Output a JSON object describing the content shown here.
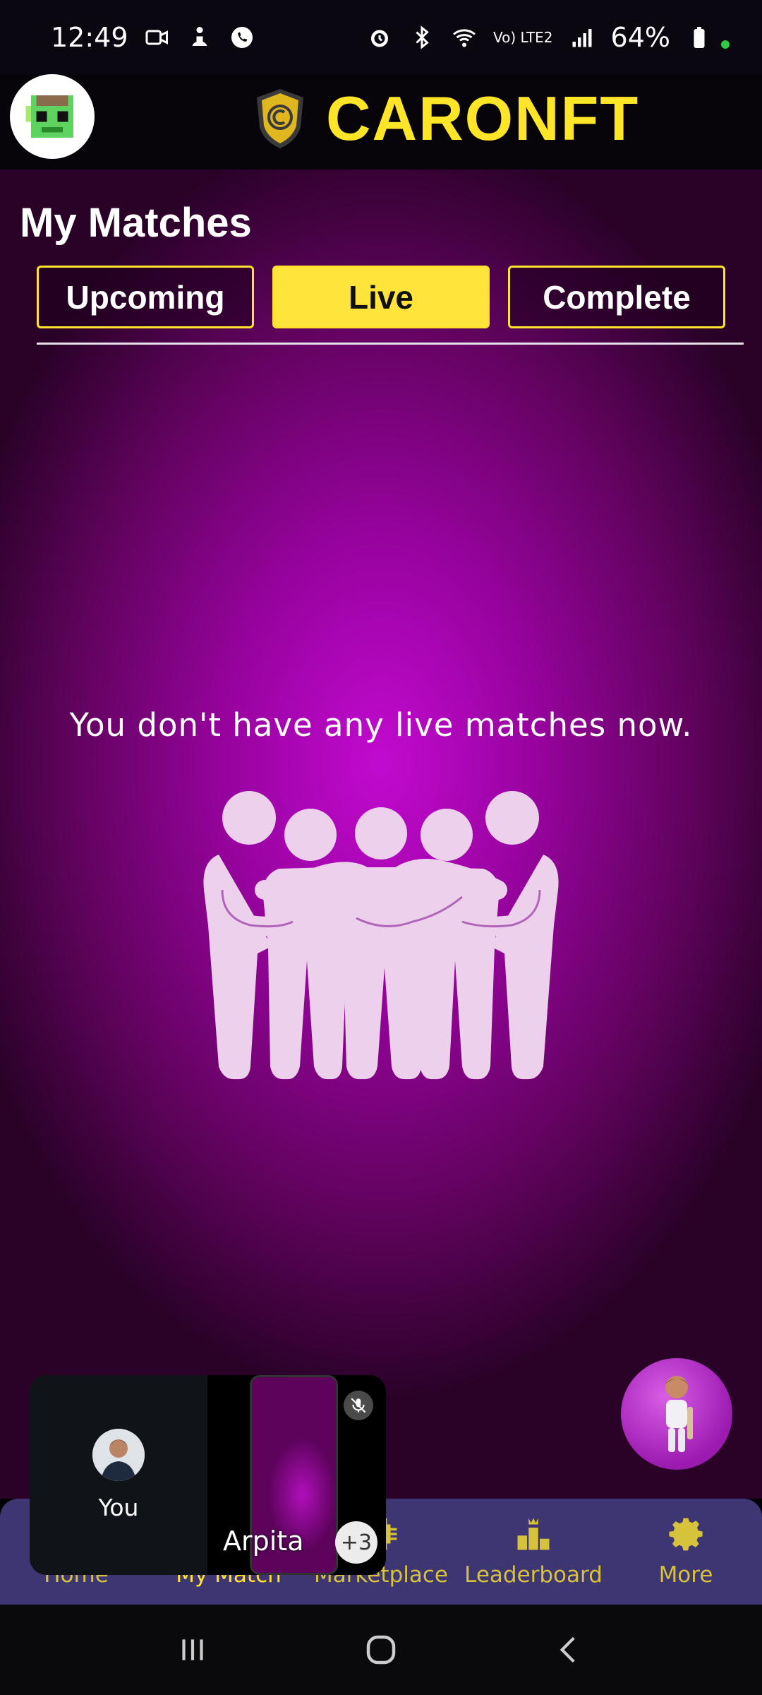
{
  "status_bar": {
    "time": "12:49",
    "battery": "64%",
    "network_label": "Vo) LTE2"
  },
  "header": {
    "brand_name": "CARONFT",
    "brand_color": "#ffe528"
  },
  "page": {
    "title": "My Matches",
    "tabs": [
      {
        "label": "Upcoming",
        "active": false
      },
      {
        "label": "Live",
        "active": true
      },
      {
        "label": "Complete",
        "active": false
      }
    ],
    "empty_message": "You don't have any live matches now."
  },
  "bottom_nav": {
    "items": [
      {
        "label": "Home",
        "icon": "home-icon"
      },
      {
        "label": "My Match",
        "icon": "trophy-icon",
        "active": true
      },
      {
        "label": "Marketplace",
        "icon": "chip-icon"
      },
      {
        "label": "Leaderboard",
        "icon": "podium-icon"
      },
      {
        "label": "More",
        "icon": "gear-icon"
      }
    ]
  },
  "call_overlay": {
    "self_label": "You",
    "remote_name": "Arpita",
    "extra_participants": "+3"
  },
  "colors": {
    "accent": "#ffe53b",
    "nav_bg": "#3e3573",
    "content_center": "#c20ad0"
  }
}
